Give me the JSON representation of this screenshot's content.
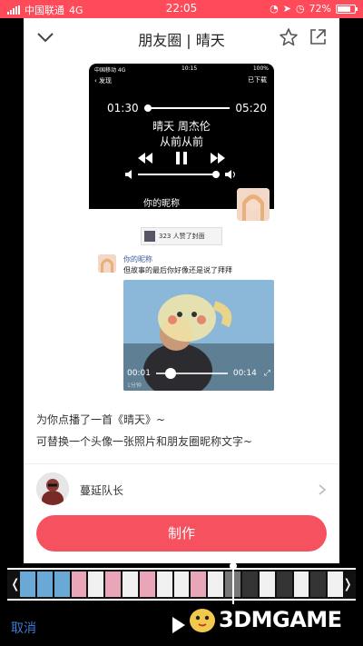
{
  "status_bar": {
    "carrier": "中国联通",
    "network": "4G",
    "time": "22:05",
    "battery": "72%"
  },
  "header": {
    "title": "朋友圈 | 晴天"
  },
  "preview": {
    "status": {
      "carrier": "中国移动 4G",
      "time": "10:15",
      "battery": "100%"
    },
    "nav_back": "发现",
    "tag": "已下载",
    "time_start": "01:30",
    "time_end": "05:20",
    "song": "晴天  周杰伦",
    "lyric": "从前从前",
    "nickname": "你的昵称",
    "likes": "323 人赞了封面"
  },
  "comment": {
    "name": "你的昵称",
    "text": "但故事的最后你好像还是说了拜拜"
  },
  "video": {
    "time_start": "00:01",
    "time_end": "00:14",
    "bottom": "1分钟"
  },
  "description": [
    "为你点播了一首《晴天》~",
    "可替换一个头像一张照片和朋友圈昵称文字~"
  ],
  "author": {
    "name": "蔓延队长"
  },
  "actions": {
    "make": "制作",
    "cancel": "取消"
  },
  "watermark": {
    "text": "3DMGAME"
  }
}
